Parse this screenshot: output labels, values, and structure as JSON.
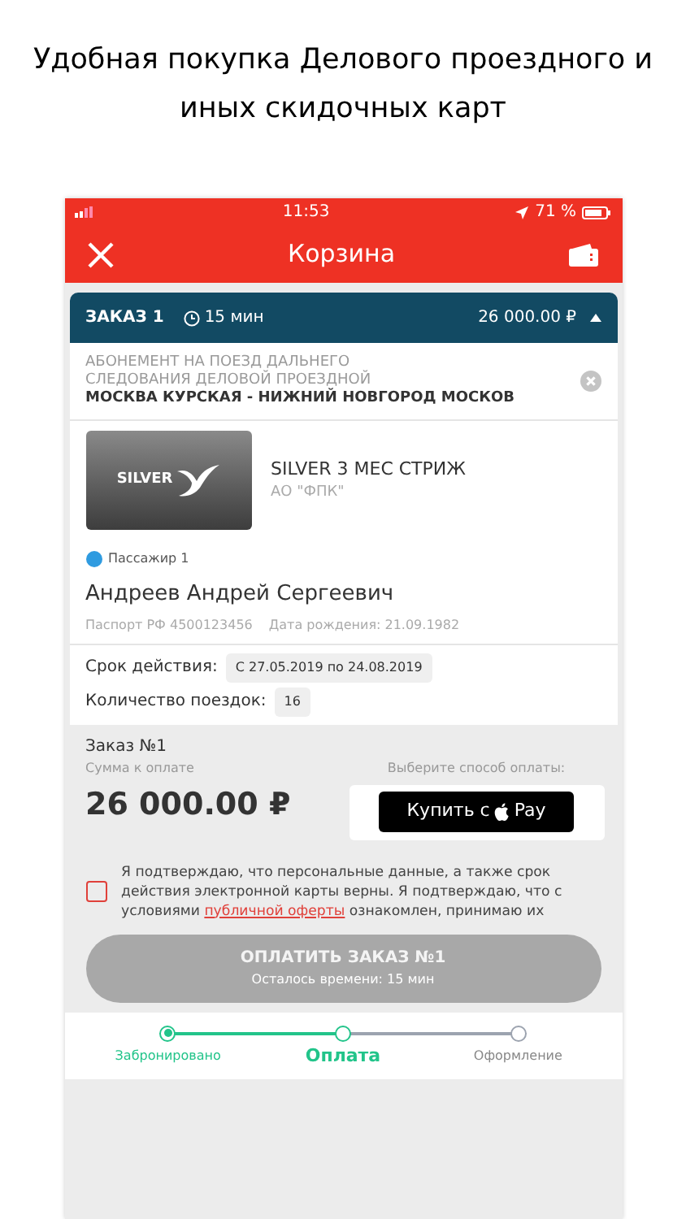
{
  "caption": "Удобная покупка Делового проездного и иных скидочных карт",
  "status_bar": {
    "time": "11:53",
    "battery": "71 %"
  },
  "nav": {
    "title": "Корзина"
  },
  "order": {
    "title": "ЗАКАЗ 1",
    "timer": "15 мин",
    "total": "26 000.00 ₽",
    "expanded": true,
    "item": {
      "type": "АБОНЕМЕНТ НА ПОЕЗД ДАЛЬНЕГО СЛЕДОВАНИЯ ДЕЛОВОЙ ПРОЕЗДНОЙ",
      "route": "МОСКВА КУРСКАЯ - НИЖНИЙ НОВГОРОД МОСКОВ"
    },
    "card": {
      "logo_text": "SILVER",
      "name": "SILVER 3 МЕС СТРИЖ",
      "issuer": "АО \"ФПК\""
    },
    "passenger": {
      "label": "Пассажир 1",
      "color": "#2f9be0",
      "name": "Андреев Андрей Сергеевич",
      "passport": "Паспорт РФ 4500123456",
      "birth": "Дата рождения: 21.09.1982"
    },
    "details": [
      {
        "label": "Срок действия:",
        "value": "С 27.05.2019 по 24.08.2019"
      },
      {
        "label": "Количество поездок:",
        "value": "16"
      }
    ]
  },
  "payment": {
    "order_label": "Заказ №1",
    "sum_label": "Сумма к оплате",
    "sum": "26 000.00 ₽",
    "method_label": "Выберите способ оплаты:",
    "apple_pay": {
      "prefix": "Купить с",
      "suffix": "Pay"
    },
    "consent": {
      "checked": false,
      "before": "Я подтверждаю, что персональные данные, а также срок действия электронной карты верны. Я подтверждаю, что с условиями",
      "link": "публичной оферты",
      "after": "ознакомлен, принимаю их"
    },
    "pay_button": {
      "label": "ОПЛАТИТЬ ЗАКАЗ №1",
      "sub": "Осталось времени: 15 мин",
      "disabled": true
    }
  },
  "steps": [
    {
      "label": "Забронировано",
      "kind": "done"
    },
    {
      "label": "Оплата",
      "kind": "current"
    },
    {
      "label": "Оформление",
      "kind": "todo"
    }
  ]
}
